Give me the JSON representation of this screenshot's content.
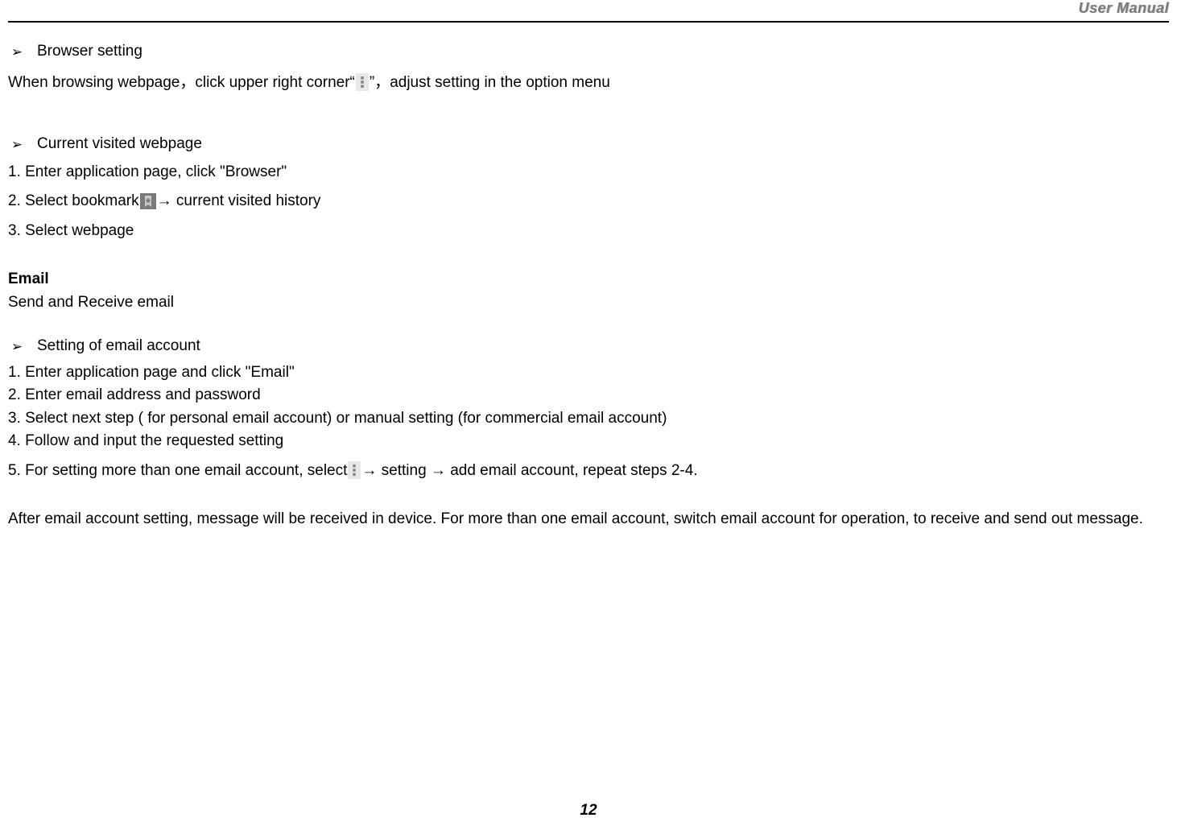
{
  "header": {
    "label": "User Manual"
  },
  "bullets": {
    "browser_setting": "Browser setting",
    "current_visited": "Current visited webpage",
    "setting_email": "Setting of email account"
  },
  "browser_line": {
    "before": "When browsing webpage，click upper right corner“",
    "after": "”，adjust setting in the option menu"
  },
  "current": {
    "l1": "1. Enter application page, click \"Browser\"",
    "l2a": "2. Select bookmark",
    "l2b": "→ current visited history",
    "l3": "3. Select webpage"
  },
  "email_section": {
    "title": "Email",
    "sub": "Send and Receive email"
  },
  "email_steps": {
    "l1": "1. Enter application page and click \"Email\"",
    "l2": "2. Enter email address and password",
    "l3": "3. Select next step ( for personal email account) or manual setting (for commercial email account)",
    "l4": "4. Follow and input the requested setting",
    "l5a": "5. For setting more than one email account, select ",
    "l5b": "→ setting → add email account, repeat steps 2-4."
  },
  "email_after": "After email account setting, message will be received in device. For more than one email account, switch email account for operation, to receive and send out message.",
  "page_number": "12"
}
